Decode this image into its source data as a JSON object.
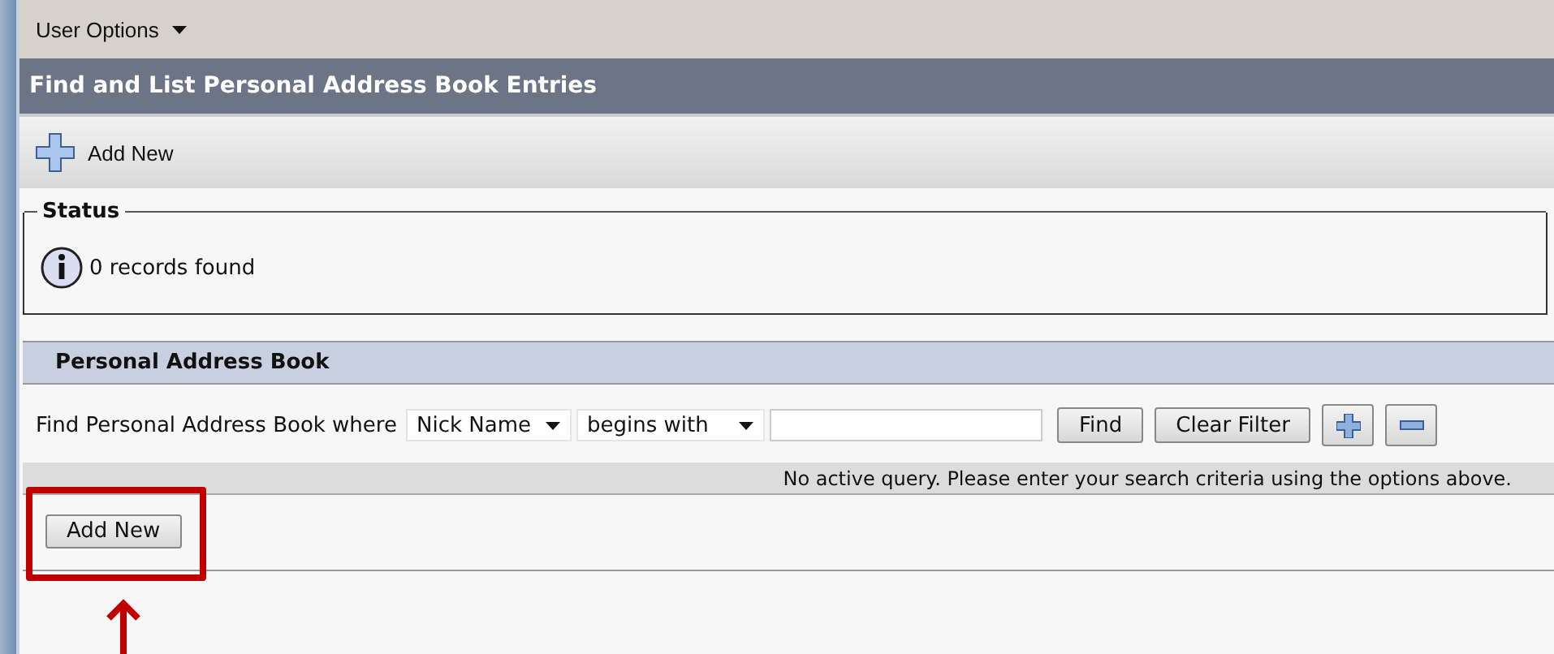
{
  "menu": {
    "label": "User Options"
  },
  "title": "Find and List Personal Address Book Entries",
  "toolbar": {
    "add_label": "Add New"
  },
  "status": {
    "legend": "Status",
    "message": "0 records found"
  },
  "panel": {
    "title": "Personal Address Book",
    "filter_label": "Find Personal Address Book where",
    "field_select": "Nick Name",
    "operator_select": "begins with",
    "buttons": [
      {
        "label": "Find",
        "kind": "text"
      },
      {
        "label": "Clear Filter",
        "kind": "text"
      },
      {
        "kind": "add"
      },
      {
        "kind": "remove"
      }
    ],
    "message": "No active query. Please enter your search criteria using the options above.",
    "add_button": "Add New"
  },
  "annotation": {
    "highlight": true
  }
}
